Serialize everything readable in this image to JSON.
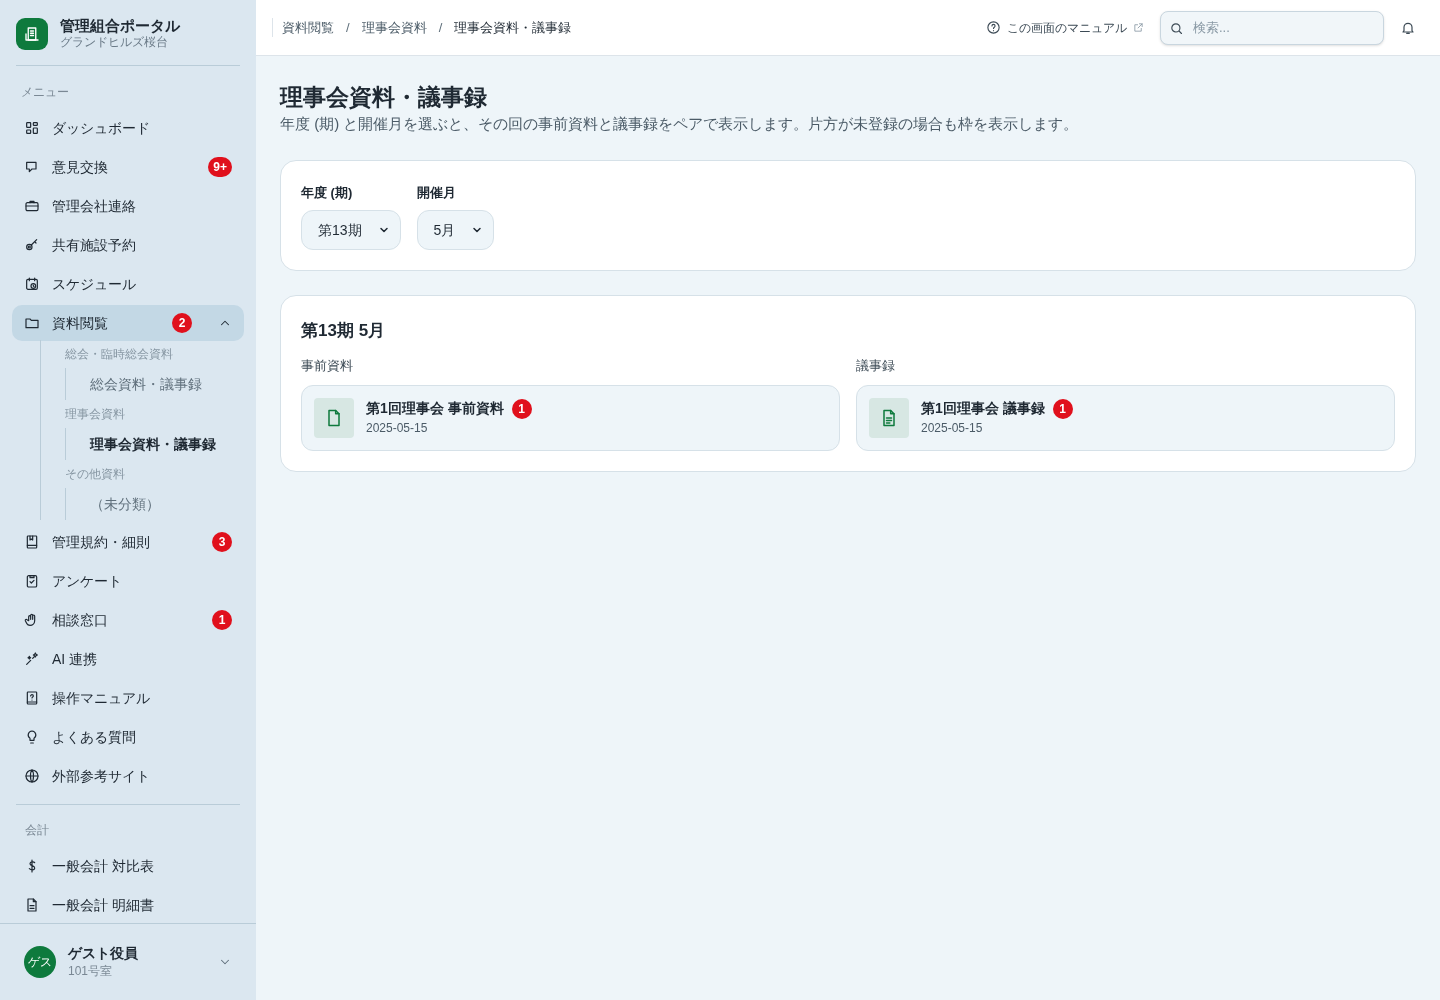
{
  "sidebar": {
    "brand": {
      "title": "管理組合ポータル",
      "subtitle": "グランドヒルズ桜台"
    },
    "sections": [
      {
        "heading": "メニュー",
        "items": [
          {
            "label": "ダッシュボード",
            "selected": false
          },
          {
            "label": "意見交換",
            "badge": "9+",
            "selected": false
          },
          {
            "label": "管理会社連絡",
            "selected": false
          },
          {
            "label": "共有施設予約",
            "selected": false
          },
          {
            "label": "スケジュール",
            "selected": false
          },
          {
            "label": "資料閲覧",
            "badge": "2",
            "selected": true,
            "expanded": true,
            "children": [
              {
                "label": "総会・臨時総会資料",
                "children": [
                  {
                    "label": "総会資料・議事録",
                    "selected": false
                  }
                ]
              },
              {
                "label": "理事会資料",
                "children": [
                  {
                    "label": "理事会資料・議事録",
                    "selected": true
                  }
                ]
              },
              {
                "label": "その他資料",
                "children": [
                  {
                    "label": "（未分類）",
                    "selected": false
                  }
                ]
              }
            ]
          },
          {
            "label": "管理規約・細則",
            "badge": "3",
            "selected": false
          },
          {
            "label": "アンケート",
            "selected": false
          },
          {
            "label": "相談窓口",
            "badge": "1",
            "selected": false
          },
          {
            "label": "AI 連携",
            "selected": false
          },
          {
            "label": "操作マニュアル",
            "selected": false
          },
          {
            "label": "よくある質問",
            "selected": false
          },
          {
            "label": "外部参考サイト",
            "selected": false
          }
        ]
      },
      {
        "heading": "会計",
        "items": [
          {
            "label": "一般会計 対比表",
            "selected": false
          },
          {
            "label": "一般会計 明細書",
            "selected": false
          }
        ]
      }
    ],
    "user": {
      "avatar": "ゲス",
      "name": "ゲスト役員",
      "room": "101号室"
    }
  },
  "topbar": {
    "breadcrumbs": [
      {
        "label": "資料閲覧",
        "current": false
      },
      {
        "label": "理事会資料",
        "current": false
      },
      {
        "label": "理事会資料・議事録",
        "current": true
      }
    ],
    "breadcrumb_separator": "/",
    "manual_link": "この画面のマニュアル",
    "search": {
      "placeholder": "検索..."
    }
  },
  "page": {
    "title": "理事会資料・議事録",
    "description": "年度 (期) と開催月を選ぶと、その回の事前資料と議事録をペアで表示します。片方が未登録の場合も枠を表示します。",
    "filters": [
      {
        "label": "年度 (期)",
        "value": "第13期"
      },
      {
        "label": "開催月",
        "value": "5月"
      }
    ],
    "result": {
      "heading": "第13期 5月",
      "columns": [
        {
          "label": "事前資料",
          "documents": [
            {
              "title": "第1回理事会 事前資料",
              "date": "2025-05-15",
              "badge": "1",
              "kind": "file"
            }
          ]
        },
        {
          "label": "議事録",
          "documents": [
            {
              "title": "第1回理事会 議事録",
              "date": "2025-05-15",
              "badge": "1",
              "kind": "text"
            }
          ]
        }
      ]
    }
  }
}
